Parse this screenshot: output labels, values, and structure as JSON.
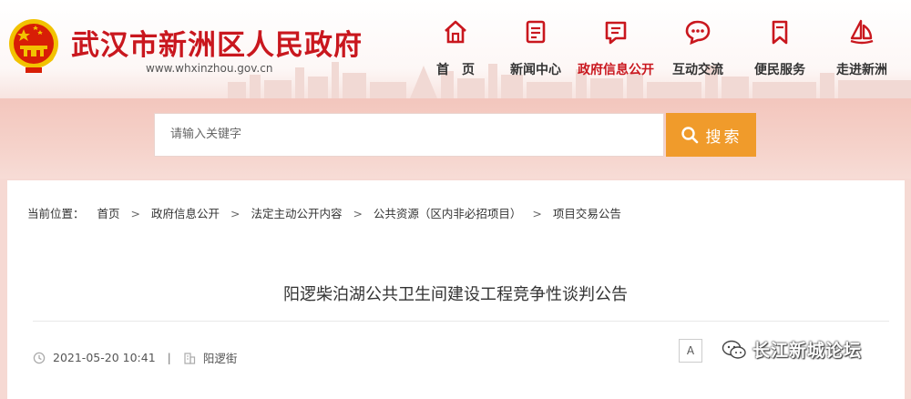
{
  "header": {
    "site_title": "武汉市新洲区人民政府",
    "site_url": "www.whxinzhou.gov.cn"
  },
  "nav": {
    "items": [
      {
        "label": "首　页",
        "icon": "home-icon"
      },
      {
        "label": "新闻中心",
        "icon": "news-icon"
      },
      {
        "label": "政府信息公开",
        "icon": "info-disclosure-icon",
        "active": true
      },
      {
        "label": "互动交流",
        "icon": "chat-icon"
      },
      {
        "label": "便民服务",
        "icon": "bookmark-icon"
      },
      {
        "label": "走进新洲",
        "icon": "sail-icon"
      }
    ]
  },
  "search": {
    "placeholder": "请输入关键字",
    "button_label": "搜索"
  },
  "breadcrumb": {
    "prefix": "当前位置：",
    "items": [
      "首页",
      "政府信息公开",
      "法定主动公开内容",
      "公共资源（区内非必招项目）",
      "项目交易公告"
    ],
    "separator": ">"
  },
  "article": {
    "title": "阳逻柴泊湖公共卫生间建设工程竞争性谈判公告",
    "date": "2021-05-20 10:41",
    "separator": "|",
    "source": "阳逻街"
  },
  "tools": {
    "font_button": "A"
  },
  "watermark": {
    "text": "长江新城论坛"
  },
  "colors": {
    "brand_red": "#c9171e",
    "search_orange": "#f09b2b",
    "band_pink": "#f3c6bd"
  }
}
